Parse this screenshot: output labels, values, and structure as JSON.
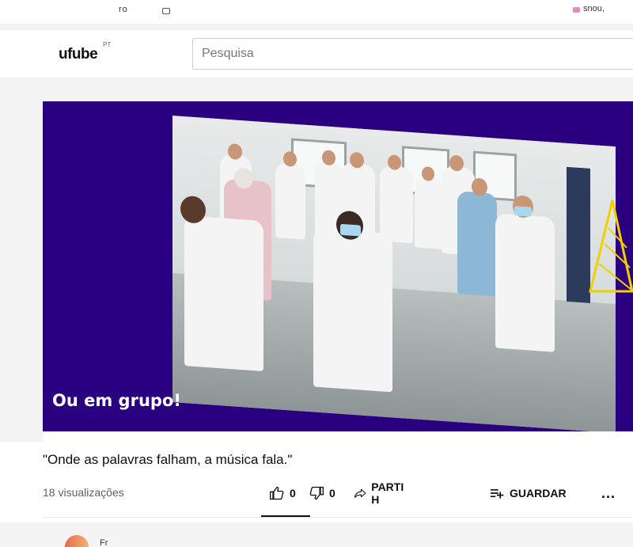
{
  "top_strip": {
    "left_fragment": "ro",
    "right_fragment": "snou,"
  },
  "header": {
    "logo_text": "ufube",
    "region": "PT",
    "search_placeholder": "Pesquisa"
  },
  "video": {
    "overlay_caption": "Ou em grupo!",
    "background_color": "#2a0080"
  },
  "video_info": {
    "title": "\"Onde as palavras falham, a música fala.\"",
    "views": "18 visualizações",
    "likes": "0",
    "dislikes": "0",
    "share_label": "PARTI H",
    "save_label": "GUARDAR",
    "more_label": "..."
  },
  "channel": {
    "name_fragment": "Fr"
  },
  "icons": {
    "like": "thumb-up-icon",
    "dislike": "thumb-down-icon",
    "share": "share-arrow-icon",
    "save": "playlist-add-icon",
    "more": "more-horizontal-icon"
  }
}
